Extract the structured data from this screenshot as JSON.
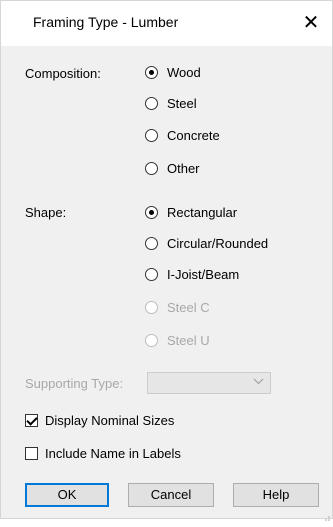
{
  "window": {
    "title": "Framing Type - Lumber",
    "close_glyph": "✕"
  },
  "composition": {
    "label": "Composition:",
    "options": [
      {
        "label": "Wood",
        "checked": true,
        "disabled": false
      },
      {
        "label": "Steel",
        "checked": false,
        "disabled": false
      },
      {
        "label": "Concrete",
        "checked": false,
        "disabled": false
      },
      {
        "label": "Other",
        "checked": false,
        "disabled": false
      }
    ]
  },
  "shape": {
    "label": "Shape:",
    "options": [
      {
        "label": "Rectangular",
        "checked": true,
        "disabled": false
      },
      {
        "label": "Circular/Rounded",
        "checked": false,
        "disabled": false
      },
      {
        "label": "I-Joist/Beam",
        "checked": false,
        "disabled": false
      },
      {
        "label": "Steel C",
        "checked": false,
        "disabled": true
      },
      {
        "label": "Steel U",
        "checked": false,
        "disabled": true
      }
    ]
  },
  "supporting_type": {
    "label": "Supporting Type:",
    "value": "",
    "disabled": true
  },
  "checkboxes": {
    "display_nominal": {
      "label": "Display Nominal Sizes",
      "checked": true
    },
    "include_name": {
      "label": "Include Name in Labels",
      "checked": false
    }
  },
  "buttons": {
    "ok": "OK",
    "cancel": "Cancel",
    "help": "Help"
  },
  "colors": {
    "accent": "#0078d7",
    "disabled_text": "#a8a8a8",
    "body_bg": "#f0f0f0"
  }
}
